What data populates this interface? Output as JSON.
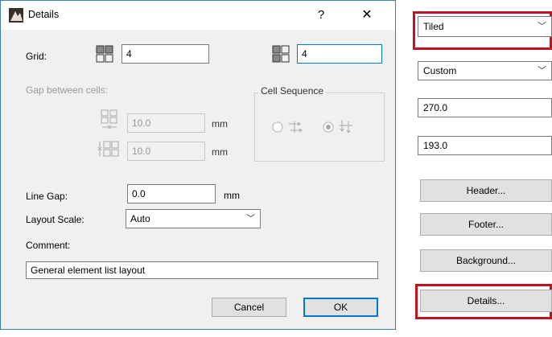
{
  "dialog": {
    "title": "Details",
    "help_glyph": "?",
    "close_glyph": "✕",
    "grid_label": "Grid:",
    "grid_cols_value": "4",
    "grid_rows_value": "4",
    "gap_label": "Gap between cells:",
    "gap_h_value": "10.0",
    "gap_v_value": "10.0",
    "unit_mm": "mm",
    "cell_sequence_label": "Cell Sequence",
    "line_gap_label": "Line Gap:",
    "line_gap_value": "0.0",
    "layout_scale_label": "Layout Scale:",
    "layout_scale_value": "Auto",
    "comment_label": "Comment:",
    "comment_value": "General element list layout",
    "cancel_label": "Cancel",
    "ok_label": "OK"
  },
  "right_panel": {
    "mode_select": "Tiled",
    "size_select": "Custom",
    "width_value": "270.0",
    "height_value": "193.0",
    "header_button": "Header...",
    "footer_button": "Footer...",
    "background_button": "Background...",
    "details_button": "Details..."
  },
  "colors": {
    "highlight": "#c1121f",
    "focus_border": "#0078d7",
    "dialog_border": "#3d7ab8"
  },
  "icons": [
    "app-logo-icon",
    "help-icon",
    "close-icon",
    "grid-columns-icon",
    "grid-rows-icon",
    "gap-horizontal-icon",
    "gap-vertical-icon",
    "sequence-horizontal-icon",
    "sequence-vertical-icon",
    "chevron-down-icon"
  ]
}
